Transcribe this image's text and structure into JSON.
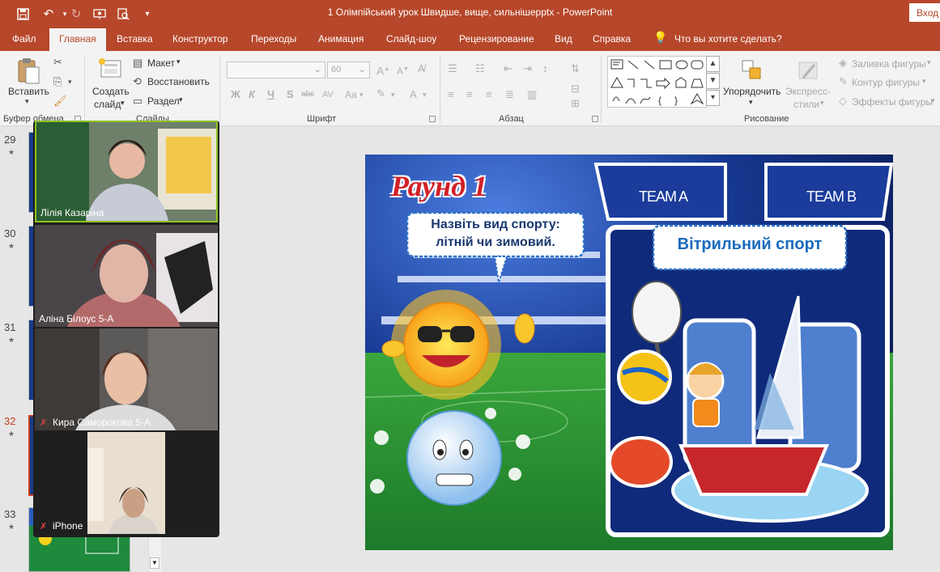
{
  "titlebar": {
    "document_title": "1 Олімпійський урок Швидше, вище, сильнішеpptx  -  PowerPoint",
    "login_label": "Вход",
    "qa_icons": [
      "save-icon",
      "undo-icon",
      "redo-icon",
      "present-icon",
      "preview-icon",
      "customize-icon"
    ]
  },
  "tabs": [
    "Файл",
    "Главная",
    "Вставка",
    "Конструктор",
    "Переходы",
    "Анимация",
    "Слайд-шоу",
    "Рецензирование",
    "Вид",
    "Справка"
  ],
  "tell_me": "Что вы хотите сделать?",
  "ribbon": {
    "clipboard": {
      "paste_label": "Вставить",
      "group_label": "Буфер обмена"
    },
    "slides": {
      "new_slide_line1": "Создать",
      "new_slide_line2": "слайд",
      "layout": "Макет",
      "reset": "Восстановить",
      "section": "Раздел",
      "group_label": "Слайды"
    },
    "font": {
      "font_name": "",
      "font_size": "60",
      "bold": "Ж",
      "italic": "К",
      "underline": "Ч",
      "strike": "S",
      "shadow": "abc",
      "spacing": "AV",
      "case": "Aa",
      "color": "A",
      "group_label": "Шрифт"
    },
    "paragraph": {
      "group_label": "Абзац"
    },
    "drawing": {
      "arrange": "Упорядочить",
      "styles_line1": "Экспресс-",
      "styles_line2": "стили",
      "fill": "Заливка фигуры",
      "outline": "Контур фигуры",
      "effects": "Эффекты фигуры",
      "group_label": "Рисование"
    }
  },
  "slide_numbers": [
    "29",
    "30",
    "31",
    "32",
    "33"
  ],
  "selected_slide": "32",
  "slide": {
    "round": "Раунд 1",
    "question_line1": "Назвіть вид спорту:",
    "question_line2": "літній чи зимовий.",
    "team_a": "TEAM A",
    "team_b": "TEAM B",
    "answer": "Вітрильний спорт"
  },
  "participants": [
    {
      "name": "Лілія Казаріна",
      "muted": false
    },
    {
      "name": "Аліна Білоус 5-А",
      "muted": false
    },
    {
      "name": "Кира Саморокова 5-А",
      "muted": true
    },
    {
      "name": "iPhone",
      "muted": true
    }
  ],
  "colors": {
    "accent": "#b7472a",
    "selected": "#c43e1c",
    "slide_bg": "#173a89",
    "answer_text": "#1a6bbd",
    "round_text": "#d32027"
  }
}
